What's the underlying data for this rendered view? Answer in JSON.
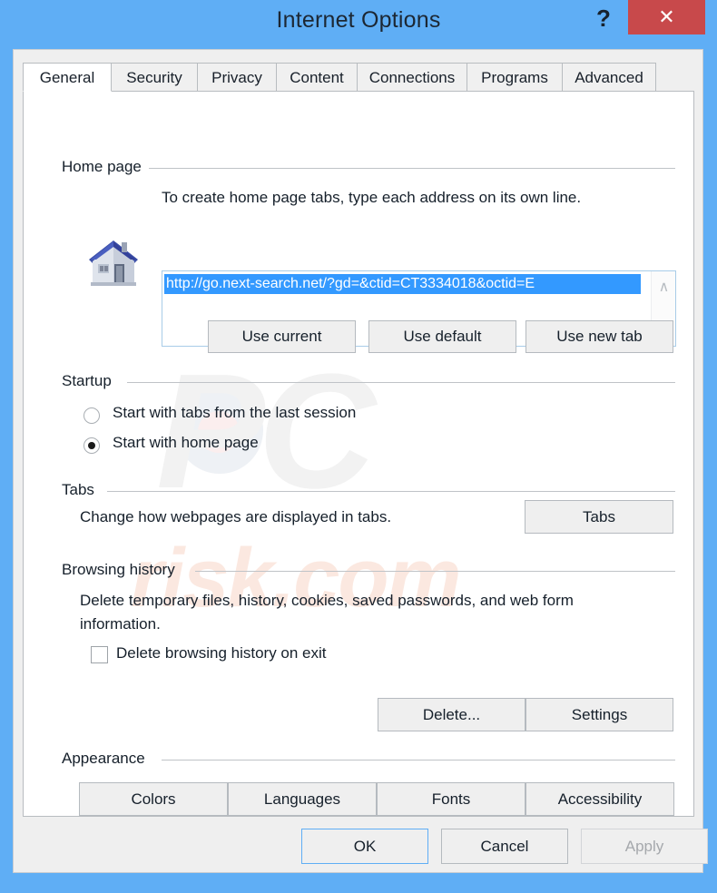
{
  "window": {
    "title": "Internet Options",
    "help_label": "?",
    "close_label": "✕",
    "frame_color": "#5faef5",
    "close_color": "#c8494b"
  },
  "tabs": [
    {
      "label": "General",
      "active": true
    },
    {
      "label": "Security",
      "active": false
    },
    {
      "label": "Privacy",
      "active": false
    },
    {
      "label": "Content",
      "active": false
    },
    {
      "label": "Connections",
      "active": false
    },
    {
      "label": "Programs",
      "active": false
    },
    {
      "label": "Advanced",
      "active": false
    }
  ],
  "watermark": {
    "brand": "PC",
    "suffix": "risk.com"
  },
  "home_page": {
    "group_label": "Home page",
    "instruction": "To create home page tabs, type each address on its own line.",
    "url_value": "http://go.next-search.net/?gd=&ctid=CT3334018&octid=E",
    "icon": "house-icon",
    "scroll_up": "∧",
    "scroll_down": "∨",
    "buttons": {
      "use_current": "Use current",
      "use_default": "Use default",
      "use_new_tab": "Use new tab"
    }
  },
  "startup": {
    "group_label": "Startup",
    "options": [
      {
        "label": "Start with tabs from the last session",
        "selected": false
      },
      {
        "label": "Start with home page",
        "selected": true
      }
    ]
  },
  "tabs_section": {
    "group_label": "Tabs",
    "description": "Change how webpages are displayed in tabs.",
    "button_label": "Tabs"
  },
  "browsing_history": {
    "group_label": "Browsing history",
    "description": "Delete temporary files, history, cookies, saved passwords, and web form information.",
    "checkbox_label": "Delete browsing history on exit",
    "checkbox_checked": false,
    "buttons": {
      "delete": "Delete...",
      "settings": "Settings"
    }
  },
  "appearance": {
    "group_label": "Appearance",
    "buttons": {
      "colors": "Colors",
      "languages": "Languages",
      "fonts": "Fonts",
      "accessibility": "Accessibility"
    }
  },
  "footer": {
    "ok": "OK",
    "cancel": "Cancel",
    "apply": "Apply",
    "apply_disabled": true
  }
}
